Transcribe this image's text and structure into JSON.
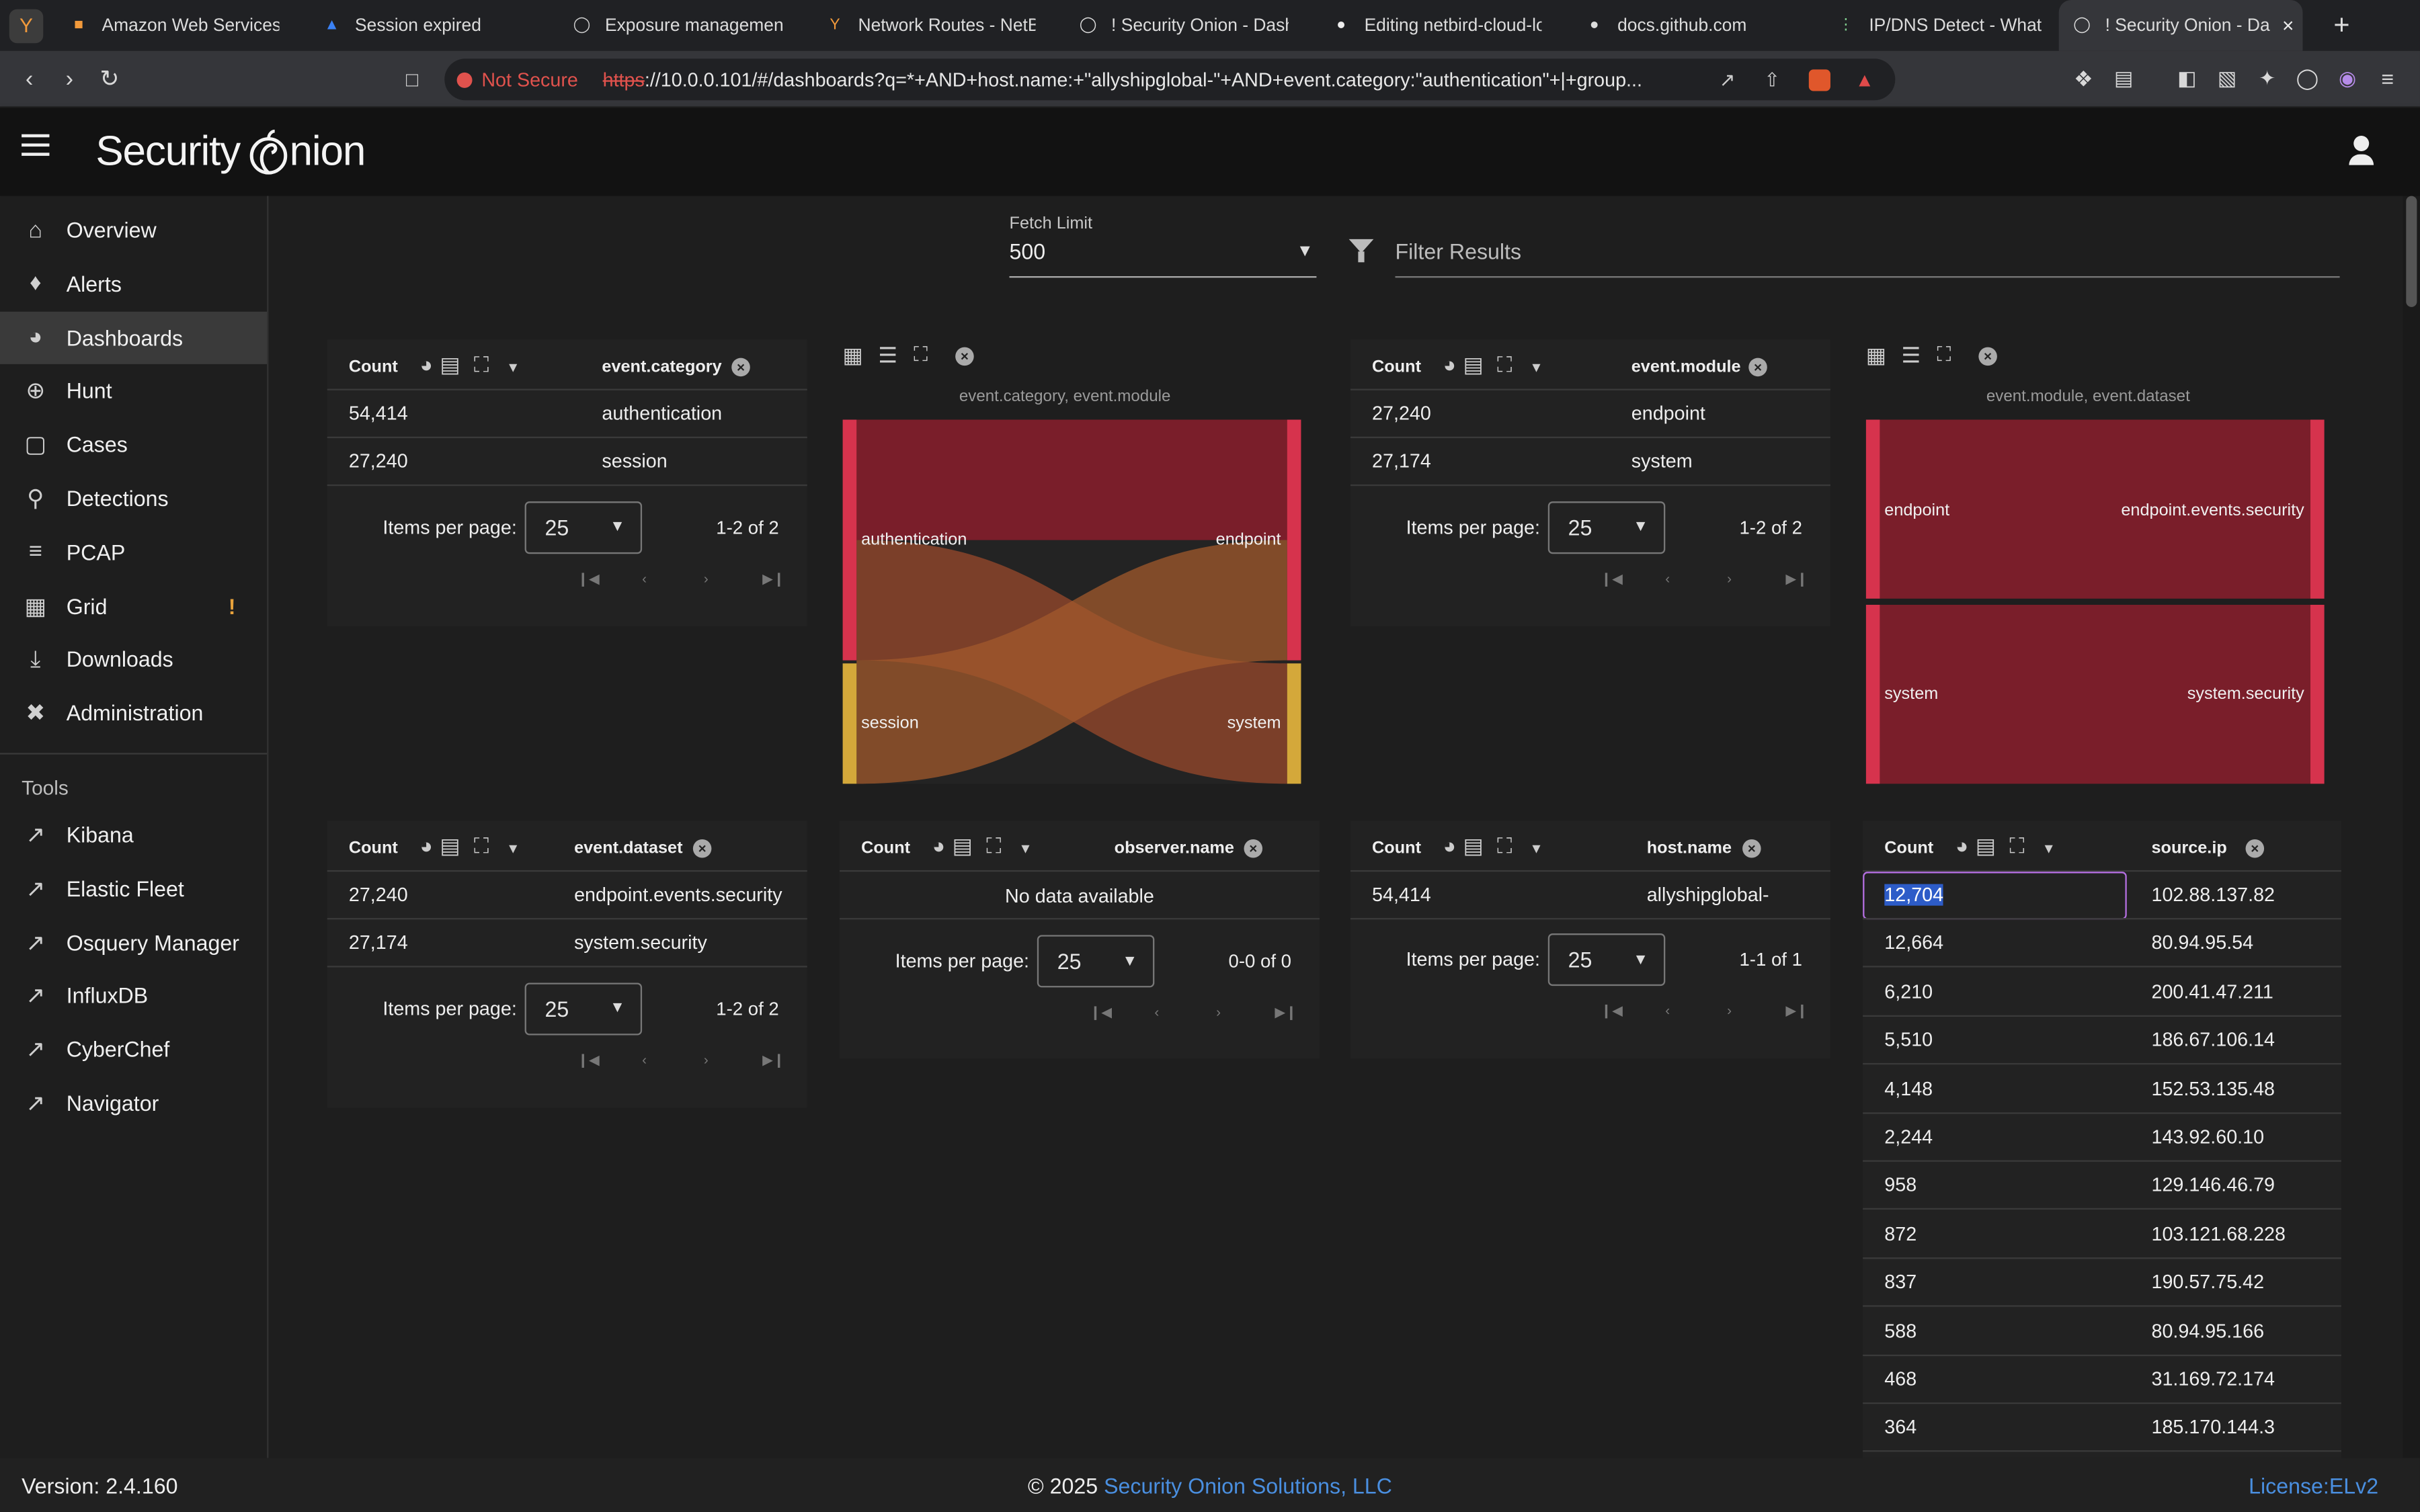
{
  "browser": {
    "tabs": [
      {
        "title": "Amazon Web Services S"
      },
      {
        "title": "Session expired"
      },
      {
        "title": "Exposure management c"
      },
      {
        "title": "Network Routes - NetBir"
      },
      {
        "title": "! Security Onion - Dashb"
      },
      {
        "title": "Editing netbird-cloud-lo"
      },
      {
        "title": "docs.github.com"
      },
      {
        "title": "IP/DNS Detect - What is"
      },
      {
        "title": "! Security Onion - Da"
      }
    ],
    "security_label": "Not Secure",
    "url_scheme": "https",
    "url_rest": "://10.0.0.101/#/dashboards?q=*+AND+host.name:+\"allyshipglobal-\"+AND+event.category:\"authentication\"+|+group..."
  },
  "app": {
    "logo_word1": "Security",
    "logo_word2": "nion"
  },
  "sidebar": {
    "items": [
      {
        "label": "Overview",
        "icon": "home-icon"
      },
      {
        "label": "Alerts",
        "icon": "bell-icon"
      },
      {
        "label": "Dashboards",
        "icon": "pie-chart-icon"
      },
      {
        "label": "Hunt",
        "icon": "crosshair-icon"
      },
      {
        "label": "Cases",
        "icon": "briefcase-icon"
      },
      {
        "label": "Detections",
        "icon": "search-icon"
      },
      {
        "label": "PCAP",
        "icon": "list-icon"
      },
      {
        "label": "Grid",
        "icon": "grid-icon",
        "badge": "!"
      },
      {
        "label": "Downloads",
        "icon": "download-icon"
      },
      {
        "label": "Administration",
        "icon": "tools-icon"
      }
    ],
    "tools_heading": "Tools",
    "tools": [
      {
        "label": "Kibana"
      },
      {
        "label": "Elastic Fleet"
      },
      {
        "label": "Osquery Manager"
      },
      {
        "label": "InfluxDB"
      },
      {
        "label": "CyberChef"
      },
      {
        "label": "Navigator"
      }
    ]
  },
  "filters": {
    "fetch_limit_label": "Fetch Limit",
    "fetch_limit_value": "500",
    "filter_placeholder": "Filter Results"
  },
  "tables": {
    "common": {
      "count_label": "Count",
      "items_per_page_label": "Items per page:",
      "items_per_page": "25"
    },
    "category": {
      "field": "event.category",
      "range": "1-2 of 2",
      "rows": [
        {
          "count": "54,414",
          "value": "authentication"
        },
        {
          "count": "27,240",
          "value": "session"
        }
      ]
    },
    "module": {
      "field": "event.module",
      "range": "1-2 of 2",
      "rows": [
        {
          "count": "27,240",
          "value": "endpoint"
        },
        {
          "count": "27,174",
          "value": "system"
        }
      ]
    },
    "dataset": {
      "field": "event.dataset",
      "range": "1-2 of 2",
      "rows": [
        {
          "count": "27,240",
          "value": "endpoint.events.security"
        },
        {
          "count": "27,174",
          "value": "system.security"
        }
      ]
    },
    "observer": {
      "field": "observer.name",
      "range": "0-0 of 0",
      "empty": "No data available"
    },
    "host": {
      "field": "host.name",
      "range": "1-1 of 1",
      "rows": [
        {
          "count": "54,414",
          "value": "allyshipglobal-"
        }
      ]
    },
    "source": {
      "field": "source.ip",
      "rows": [
        {
          "count": "12,704",
          "value": "102.88.137.82"
        },
        {
          "count": "12,664",
          "value": "80.94.95.54"
        },
        {
          "count": "6,210",
          "value": "200.41.47.211"
        },
        {
          "count": "5,510",
          "value": "186.67.106.14"
        },
        {
          "count": "4,148",
          "value": "152.53.135.48"
        },
        {
          "count": "2,244",
          "value": "143.92.60.10"
        },
        {
          "count": "958",
          "value": "129.146.46.79"
        },
        {
          "count": "872",
          "value": "103.121.68.228"
        },
        {
          "count": "837",
          "value": "190.57.75.42"
        },
        {
          "count": "588",
          "value": "80.94.95.166"
        },
        {
          "count": "468",
          "value": "31.169.72.174"
        },
        {
          "count": "364",
          "value": "185.170.144.3"
        }
      ]
    }
  },
  "sankeys": {
    "cat_module": {
      "title": "event.category, event.module",
      "left": [
        "authentication",
        "session"
      ],
      "right": [
        "endpoint",
        "system"
      ]
    },
    "module_dataset": {
      "title": "event.module, event.dataset",
      "left": [
        "endpoint",
        "system"
      ],
      "right": [
        "endpoint.events.security",
        "system.security"
      ]
    }
  },
  "footer": {
    "version": "Version: 2.4.160",
    "copyright": "© 2025 ",
    "company": "Security Onion Solutions, LLC",
    "license": "License:ELv2"
  },
  "colors": {
    "accent": "#4a8fe0",
    "sankey_red": "#7a1e2a",
    "sankey_bar_red": "#d6334d",
    "sankey_bar_gold": "#d4a83a",
    "grid_badge": "#e8a23b"
  }
}
